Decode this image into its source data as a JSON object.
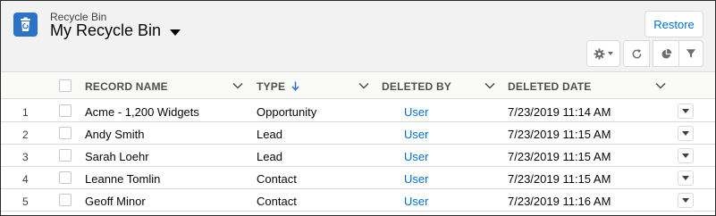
{
  "header": {
    "eyebrow": "Recycle Bin",
    "title": "My Recycle Bin",
    "app_icon": "recycle-bin-icon",
    "restore_label": "Restore",
    "toolbar_icons": [
      "gear-icon",
      "refresh-icon",
      "chart-icon",
      "filter-icon"
    ]
  },
  "table": {
    "columns": [
      {
        "label": "RECORD NAME"
      },
      {
        "label": "TYPE",
        "sort": "descending"
      },
      {
        "label": "DELETED BY"
      },
      {
        "label": "DELETED DATE"
      }
    ],
    "rows": [
      {
        "num": "1",
        "name": "Acme - 1,200 Widgets",
        "type": "Opportunity",
        "deleted_by": "User",
        "deleted_date": "7/23/2019 11:14 AM"
      },
      {
        "num": "2",
        "name": "Andy Smith",
        "type": "Lead",
        "deleted_by": "User",
        "deleted_date": "7/23/2019 11:15 AM"
      },
      {
        "num": "3",
        "name": "Sarah Loehr",
        "type": "Lead",
        "deleted_by": "User",
        "deleted_date": "7/23/2019 11:15 AM"
      },
      {
        "num": "4",
        "name": "Leanne Tomlin",
        "type": "Contact",
        "deleted_by": "User",
        "deleted_date": "7/23/2019 11:15 AM"
      },
      {
        "num": "5",
        "name": "Geoff Minor",
        "type": "Contact",
        "deleted_by": "User",
        "deleted_date": "7/23/2019 11:16 AM"
      }
    ]
  },
  "colors": {
    "brand_icon": "#2a73c6",
    "link": "#0070d2",
    "header_bg": "#f3f2f2"
  }
}
